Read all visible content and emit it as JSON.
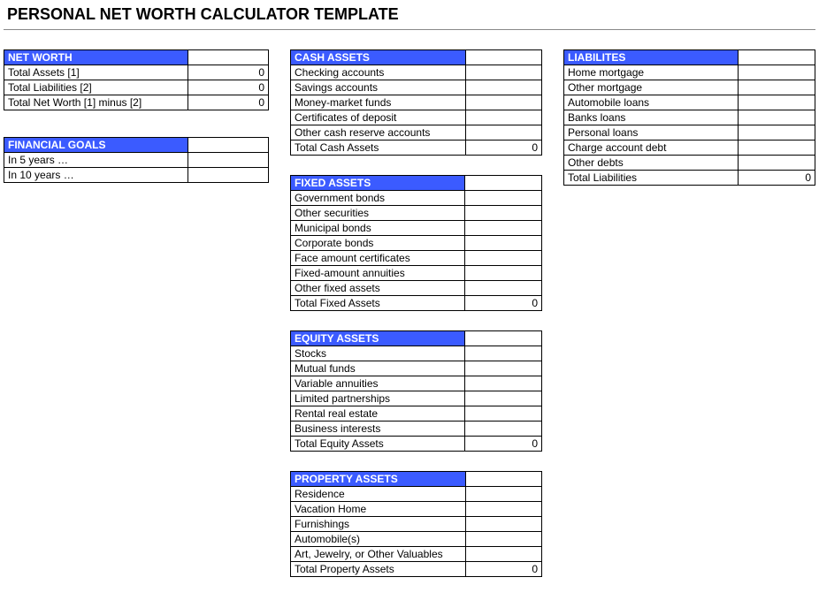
{
  "title": "PERSONAL NET WORTH CALCULATOR TEMPLATE",
  "netWorth": {
    "header": "NET WORTH",
    "rows": [
      {
        "label": "Total Assets [1]",
        "value": "0"
      },
      {
        "label": "Total Liabilities [2]",
        "value": "0"
      },
      {
        "label": "Total Net Worth [1] minus [2]",
        "value": "0"
      }
    ]
  },
  "goals": {
    "header": "FINANCIAL GOALS",
    "rows": [
      {
        "label": "In 5 years …",
        "value": ""
      },
      {
        "label": "In 10 years …",
        "value": ""
      }
    ]
  },
  "cashAssets": {
    "header": "CASH ASSETS",
    "rows": [
      {
        "label": "Checking accounts",
        "value": ""
      },
      {
        "label": "Savings accounts",
        "value": ""
      },
      {
        "label": "Money-market funds",
        "value": ""
      },
      {
        "label": "Certificates of deposit",
        "value": ""
      },
      {
        "label": "Other cash reserve accounts",
        "value": ""
      },
      {
        "label": "Total Cash Assets",
        "value": "0"
      }
    ]
  },
  "fixedAssets": {
    "header": "FIXED ASSETS",
    "rows": [
      {
        "label": "Government bonds",
        "value": ""
      },
      {
        "label": "Other securities",
        "value": ""
      },
      {
        "label": "Municipal bonds",
        "value": ""
      },
      {
        "label": "Corporate bonds",
        "value": ""
      },
      {
        "label": "Face amount certificates",
        "value": ""
      },
      {
        "label": "Fixed-amount annuities",
        "value": ""
      },
      {
        "label": "Other fixed assets",
        "value": ""
      },
      {
        "label": "Total Fixed Assets",
        "value": "0"
      }
    ]
  },
  "equityAssets": {
    "header": "EQUITY ASSETS",
    "rows": [
      {
        "label": "Stocks",
        "value": ""
      },
      {
        "label": "Mutual funds",
        "value": ""
      },
      {
        "label": "Variable annuities",
        "value": ""
      },
      {
        "label": "Limited partnerships",
        "value": ""
      },
      {
        "label": "Rental real estate",
        "value": ""
      },
      {
        "label": "Business interests",
        "value": ""
      },
      {
        "label": "Total Equity Assets",
        "value": "0"
      }
    ]
  },
  "propertyAssets": {
    "header": "PROPERTY ASSETS",
    "rows": [
      {
        "label": "Residence",
        "value": ""
      },
      {
        "label": "Vacation Home",
        "value": ""
      },
      {
        "label": "Furnishings",
        "value": ""
      },
      {
        "label": "Automobile(s)",
        "value": ""
      },
      {
        "label": "Art, Jewelry, or Other Valuables",
        "value": ""
      },
      {
        "label": "Total Property Assets",
        "value": "0"
      }
    ]
  },
  "liabilities": {
    "header": "LIABILITES",
    "rows": [
      {
        "label": "Home mortgage",
        "value": ""
      },
      {
        "label": "Other mortgage",
        "value": ""
      },
      {
        "label": "Automobile loans",
        "value": ""
      },
      {
        "label": "Banks loans",
        "value": ""
      },
      {
        "label": "Personal loans",
        "value": ""
      },
      {
        "label": "Charge account debt",
        "value": ""
      },
      {
        "label": "Other debts",
        "value": ""
      },
      {
        "label": "Total Liabilities",
        "value": "0"
      }
    ]
  }
}
